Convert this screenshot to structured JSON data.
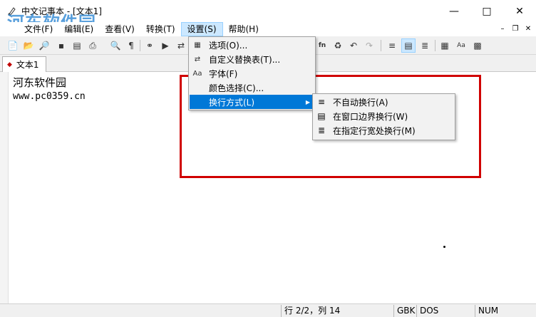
{
  "window": {
    "title": "中文记事本 - [文本1]",
    "watermark_text": "河东软件园",
    "watermark_url": "www.pc0359.cn"
  },
  "menubar": {
    "items": [
      {
        "label": "文件(F)"
      },
      {
        "label": "编辑(E)"
      },
      {
        "label": "查看(V)"
      },
      {
        "label": "转换(T)"
      },
      {
        "label": "设置(S)"
      },
      {
        "label": "帮助(H)"
      }
    ]
  },
  "tabs": [
    {
      "label": "文本1"
    }
  ],
  "editor": {
    "lines": [
      "河东软件园",
      "www.pc0359.cn"
    ]
  },
  "settings_menu": {
    "items": [
      {
        "label": "选项(O)...",
        "icon": "options-icon"
      },
      {
        "label": "自定义替换表(T)...",
        "icon": "replace-table-icon"
      },
      {
        "label": "字体(F)",
        "icon": "font-icon"
      },
      {
        "label": "颜色选择(C)...",
        "icon": ""
      },
      {
        "label": "换行方式(L)",
        "icon": "",
        "has_submenu": true
      }
    ]
  },
  "wrap_submenu": {
    "items": [
      {
        "label": "不自动换行(A)",
        "icon": "no-wrap-icon"
      },
      {
        "label": "在窗口边界换行(W)",
        "icon": "window-wrap-icon"
      },
      {
        "label": "在指定行宽处换行(M)",
        "icon": "width-wrap-icon"
      }
    ]
  },
  "statusbar": {
    "position": "行 2/2，列 14",
    "encoding": "GBK",
    "line_ending": "DOS",
    "num": "NUM"
  },
  "colors": {
    "selection": "#0078d7",
    "highlight_box": "#d00000",
    "watermark": "#3b8fd6"
  }
}
